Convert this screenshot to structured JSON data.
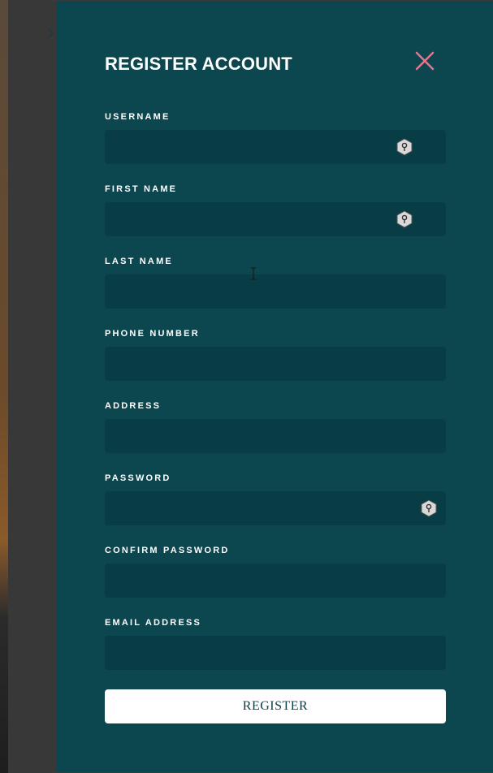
{
  "modal": {
    "title": "REGISTER ACCOUNT",
    "close_icon": "close-icon",
    "accent_color": "#e8738a",
    "panel_color": "#0c4750",
    "input_bg_color": "#093d45"
  },
  "form": {
    "fields": [
      {
        "key": "username",
        "label": "USERNAME",
        "value": "",
        "has_key_icon": true
      },
      {
        "key": "first_name",
        "label": "FIRST NAME",
        "value": "",
        "has_key_icon": true
      },
      {
        "key": "last_name",
        "label": "LAST NAME",
        "value": "",
        "has_key_icon": false
      },
      {
        "key": "phone_number",
        "label": "PHONE NUMBER",
        "value": "",
        "has_key_icon": false
      },
      {
        "key": "address",
        "label": "ADDRESS",
        "value": "",
        "has_key_icon": false
      },
      {
        "key": "password",
        "label": "PASSWORD",
        "value": "",
        "has_key_icon": true
      },
      {
        "key": "confirm_password",
        "label": "CONFIRM PASSWORD",
        "value": "",
        "has_key_icon": false
      },
      {
        "key": "email_address",
        "label": "EMAIL ADDRESS",
        "value": "",
        "has_key_icon": false
      }
    ],
    "submit_label": "REGISTER"
  }
}
